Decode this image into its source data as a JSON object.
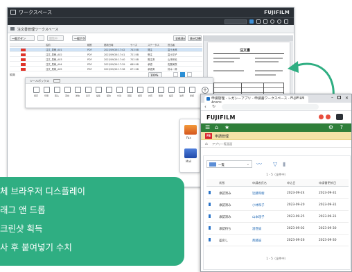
{
  "left_window": {
    "title": "ワークスペース",
    "logo": "FUJIFILM",
    "path": "注文書管理ワークスペース",
    "filter_select": "一般ボタン",
    "filter_button": "閲覧中",
    "right_buttons": [
      "全体表示",
      "表示切替"
    ],
    "columns": [
      "名前",
      "種別",
      "更新日時",
      "サイズ",
      "ステータス",
      "担当者"
    ],
    "rows": [
      {
        "name": "注文_見積_A01",
        "type": "PDF",
        "date": "2023/09/26 17:42",
        "size": "743 KB",
        "status": "発注",
        "owner": "富士太郎"
      },
      {
        "name": "注文_見積_A02",
        "type": "PDF",
        "date": "2023/09/26 17:41",
        "size": "721 KB",
        "status": "受注",
        "owner": "富士花子"
      },
      {
        "name": "注文_見積_A03",
        "type": "PDF",
        "date": "2023/09/26 17:40",
        "size": "702 KB",
        "status": "受注済",
        "owner": "山本和也"
      },
      {
        "name": "注文_見積_A04",
        "type": "PDF",
        "date": "2023/09/26 17:39",
        "size": "689 KB",
        "status": "承認",
        "owner": "佐藤美咲"
      },
      {
        "name": "注文_見積_A05",
        "type": "PDF",
        "date": "2023/09/26 17:38",
        "size": "671 KB",
        "status": "承認済",
        "owner": "鈴木一郎"
      },
      {
        "name": "注文_見積_A06",
        "type": "PDF",
        "date": "2023/09/26 17:37",
        "size": "655 KB",
        "status": "確認",
        "owner": "高橋健"
      }
    ],
    "zoom": "100%",
    "toolbox_title": "ツールボックス",
    "tools": [
      "保存",
      "印刷",
      "取込",
      "変換",
      "送信",
      "表示",
      "編集",
      "結合",
      "分割",
      "回転",
      "検索",
      "共有",
      "削除",
      "設定",
      "注釈",
      "承認"
    ],
    "side_tray_labels": [
      "Fax",
      "Mail"
    ],
    "preview_title": "注文書"
  },
  "right_window": {
    "tab_title": "申請管理 - レガシーアプリ - 申請書ワークスペース - FUJIFILM Apeos",
    "logo": "FUJIFILM",
    "app_title": "申請管理",
    "breadcrumb": "アプリ一覧画面",
    "badge": "FB",
    "view_select": "一覧",
    "page_count_top": "1 - 5（全件中）",
    "page_count_bottom": "1 - 5（全件中）",
    "columns": [
      "状態",
      "申請者氏名",
      "申込日",
      "申請書更新日"
    ],
    "rows": [
      {
        "status": "承認済み",
        "name": "近藤和樹",
        "apply": "2023-09-24",
        "updated": "2023-09-31"
      },
      {
        "status": "承認済み",
        "name": "小林和子",
        "apply": "2023-09-20",
        "updated": "2023-09-31"
      },
      {
        "status": "承認済み",
        "name": "山本理子",
        "apply": "2023-09-25",
        "updated": "2023-09-31"
      },
      {
        "status": "承認待ち",
        "name": "酒巻誠",
        "apply": "2023-09-02",
        "updated": "2023-09-30"
      },
      {
        "status": "差戻し",
        "name": "斎藤誠",
        "apply": "2023-09-26",
        "updated": "2023-09-30"
      }
    ]
  },
  "callout": {
    "lines": [
      "체 브라우저 디스플레이",
      "래그 앤 드롭",
      "크린샷 획득",
      "사 후 붙여넣기 수치"
    ]
  },
  "colors": {
    "callout_green": "#2fae82",
    "arrow_green": "#2fae82",
    "menu_green": "#2f7f3a",
    "header_dark": "#2b3036",
    "pdf_red": "#e0352b",
    "accent_blue": "#2a73c8"
  }
}
